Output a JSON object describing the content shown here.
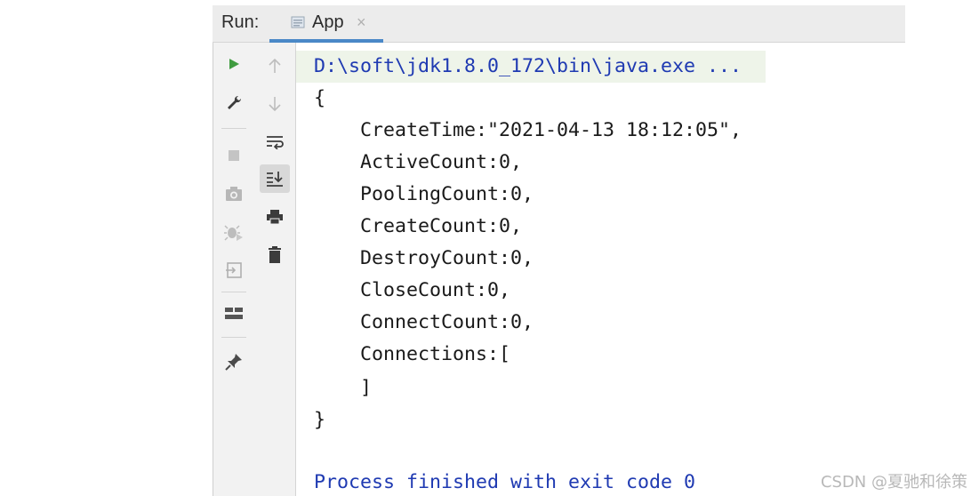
{
  "header": {
    "run_label": "Run:",
    "tab_title": "App",
    "tab_close": "×"
  },
  "toolbar": {
    "left_icons": [
      "run-icon",
      "wrench-icon",
      "stop-icon",
      "camera-icon",
      "debug-icon",
      "import-icon",
      "layout-icon",
      "pin-icon"
    ],
    "right_icons": [
      "arrow-up-icon",
      "arrow-down-icon",
      "soft-wrap-icon",
      "scroll-to-end-icon",
      "print-icon",
      "trash-icon"
    ]
  },
  "console": {
    "command": "D:\\soft\\jdk1.8.0_172\\bin\\java.exe ...",
    "lines": [
      "{",
      "    CreateTime:\"2021-04-13 18:12:05\",",
      "    ActiveCount:0,",
      "    PoolingCount:0,",
      "    CreateCount:0,",
      "    DestroyCount:0,",
      "    CloseCount:0,",
      "    ConnectCount:0,",
      "    Connections:[",
      "    ]",
      "}"
    ],
    "exit_message": "Process finished with exit code 0"
  },
  "watermark": "CSDN @夏驰和徐策",
  "colors": {
    "accent": "#4a88c7",
    "run_green": "#3f9b3f",
    "console_blue": "#1f3ab2",
    "cmd_bg": "#eef4e9"
  }
}
